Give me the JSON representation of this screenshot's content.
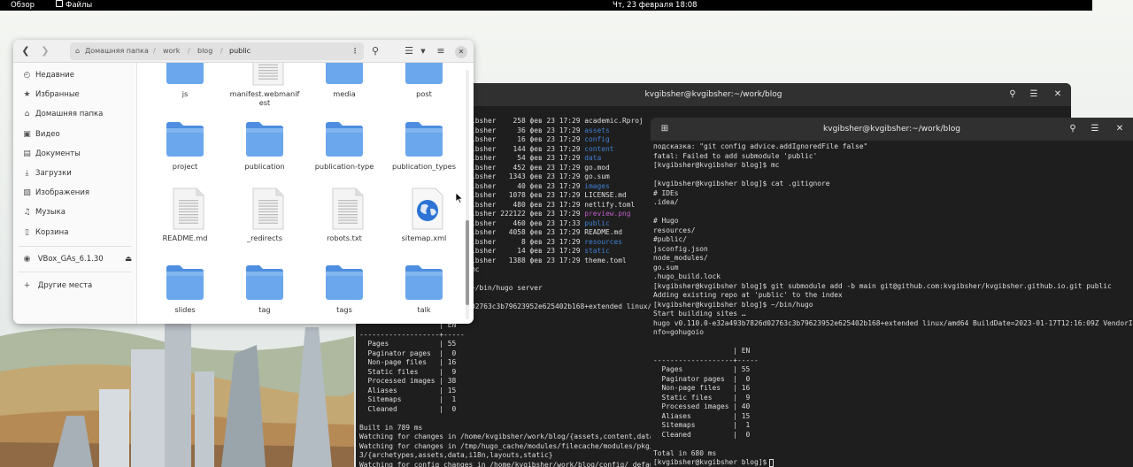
{
  "topbar": {
    "overview": "Обзор",
    "app_name": "Файлы",
    "clock": "Чт, 23 февраля  18:08"
  },
  "file_manager": {
    "path": [
      "Домашняя папка",
      "work",
      "blog",
      "public"
    ],
    "sidebar": [
      {
        "icon": "clock-icon",
        "label": "Недавние"
      },
      {
        "icon": "star-icon",
        "label": "Избранные"
      },
      {
        "icon": "home-icon",
        "label": "Домашняя папка"
      },
      {
        "icon": "video-icon",
        "label": "Видео"
      },
      {
        "icon": "document-icon",
        "label": "Документы"
      },
      {
        "icon": "download-icon",
        "label": "Загрузки"
      },
      {
        "icon": "image-icon",
        "label": "Изображения"
      },
      {
        "icon": "music-icon",
        "label": "Музыка"
      },
      {
        "icon": "trash-icon",
        "label": "Корзина"
      }
    ],
    "device": {
      "icon": "disc-icon",
      "label": "VBox_GAs_6.1.30"
    },
    "other_places": "Другие места",
    "files": [
      {
        "name": "js",
        "type": "folder"
      },
      {
        "name": "manifest.webmanif est",
        "type": "text"
      },
      {
        "name": "media",
        "type": "folder"
      },
      {
        "name": "post",
        "type": "folder"
      },
      {
        "name": "project",
        "type": "folder"
      },
      {
        "name": "publication",
        "type": "folder"
      },
      {
        "name": "publication-type",
        "type": "folder"
      },
      {
        "name": "publication_types",
        "type": "folder"
      },
      {
        "name": "README.md",
        "type": "text"
      },
      {
        "name": "_redirects",
        "type": "text"
      },
      {
        "name": "robots.txt",
        "type": "text"
      },
      {
        "name": "sitemap.xml",
        "type": "globe"
      },
      {
        "name": "slides",
        "type": "folder"
      },
      {
        "name": "tag",
        "type": "folder"
      },
      {
        "name": "tags",
        "type": "folder"
      },
      {
        "name": "talk",
        "type": "folder"
      }
    ]
  },
  "terminal_back": {
    "title": "kvgibsher@kvgibsher:~/work/blog",
    "listing": [
      {
        "text": "ibsher    258 фев 23 17:29 ",
        "name": "academic.Rproj",
        "color": "plain"
      },
      {
        "text": "ibsher     36 фев 23 17:29 ",
        "name": "assets",
        "color": "blue"
      },
      {
        "text": "ibsher     16 фев 23 17:29 ",
        "name": "config",
        "color": "blue"
      },
      {
        "text": "ibsher    144 фев 23 17:29 ",
        "name": "content",
        "color": "blue"
      },
      {
        "text": "ibsher     54 фев 23 17:29 ",
        "name": "data",
        "color": "blue"
      },
      {
        "text": "ibsher    452 фев 23 17:29 ",
        "name": "go.mod",
        "color": "plain"
      },
      {
        "text": "ibsher   1343 фев 23 17:29 ",
        "name": "go.sum",
        "color": "plain"
      },
      {
        "text": "ibsher     40 фев 23 17:29 ",
        "name": "images",
        "color": "blue"
      },
      {
        "text": "ibsher   1078 фев 23 17:29 ",
        "name": "LICENSE.md",
        "color": "plain"
      },
      {
        "text": "ibsher    480 фев 23 17:29 ",
        "name": "netlify.toml",
        "color": "plain"
      },
      {
        "text": "ibsher 222122 фев 23 17:29 ",
        "name": "preview.png",
        "color": "mag"
      },
      {
        "text": "ibsher    460 фев 23 17:33 ",
        "name": "public",
        "color": "blue"
      },
      {
        "text": "ibsher   4058 фев 23 17:29 ",
        "name": "README.md",
        "color": "plain"
      },
      {
        "text": "ibsher      8 фев 23 17:29 ",
        "name": "resources",
        "color": "blue"
      },
      {
        "text": "ibsher     14 фев 23 17:29 ",
        "name": "static",
        "color": "blue"
      },
      {
        "text": "ibsher   1388 фев 23 17:29 ",
        "name": "theme.toml",
        "color": "plain"
      }
    ],
    "lines_mid": [
      "mc",
      "",
      "~/bin/hugo server",
      "",
      "02763c3b79623952e625402b168+extended linux/a"
    ],
    "lines_bottom": [
      "                   | EN",
      "-------------------+-----",
      "  Pages            | 55",
      "  Paginator pages  |  0",
      "  Non-page files   | 16",
      "  Static files     |  9",
      "  Processed images | 38",
      "  Aliases          | 15",
      "  Sitemaps         |  1",
      "  Cleaned          |  0",
      "",
      "Built in 789 ms",
      "Watching for changes in /home/kvgibsher/work/blog/{assets,content,data,",
      "Watching for changes in /tmp/hugo_cache/modules/filecache/modules/pkg/m",
      "3/{archetypes,assets,data,i18n,layouts,static}",
      "Watching for config changes in /home/kvgibsher/work/blog/config/_defaul"
    ]
  },
  "terminal_front": {
    "title": "kvgibsher@kvgibsher:~/work/blog",
    "hint_line": "подсказка: \"git config advice.addIgnoredFile false\"",
    "lines": [
      "fatal: Failed to add submodule 'public'",
      "[kvgibsher@kvgibsher blog]$ mc",
      "",
      "[kvgibsher@kvgibsher blog]$ cat .gitignore",
      "# IDEs",
      ".idea/",
      "",
      "# Hugo",
      "resources/",
      "#public/",
      "jsconfig.json",
      "node_modules/",
      "go.sum",
      ".hugo_build.lock",
      "[kvgibsher@kvgibsher blog]$ git submodule add -b main git@github.com:kvgibsher/kvgibsher.github.io.git public",
      "Adding existing repo at 'public' to the index",
      "[kvgibsher@kvgibsher blog]$ ~/bin/hugo",
      "Start building sites …",
      "hugo v0.110.0-e32a493b7826d02763c3b79623952e625402b168+extended linux/amd64 BuildDate=2023-01-17T12:16:09Z VendorI",
      "nfo=gohugoio",
      "",
      "                   | EN",
      "-------------------+-----",
      "  Pages            | 55",
      "  Paginator pages  |  0",
      "  Non-page files   | 16",
      "  Static files     |  9",
      "  Processed images | 40",
      "  Aliases          | 15",
      "  Sitemaps         |  1",
      "  Cleaned          |  0",
      "",
      "Total in 680 ms",
      "[kvgibsher@kvgibsher blog]$ "
    ]
  }
}
